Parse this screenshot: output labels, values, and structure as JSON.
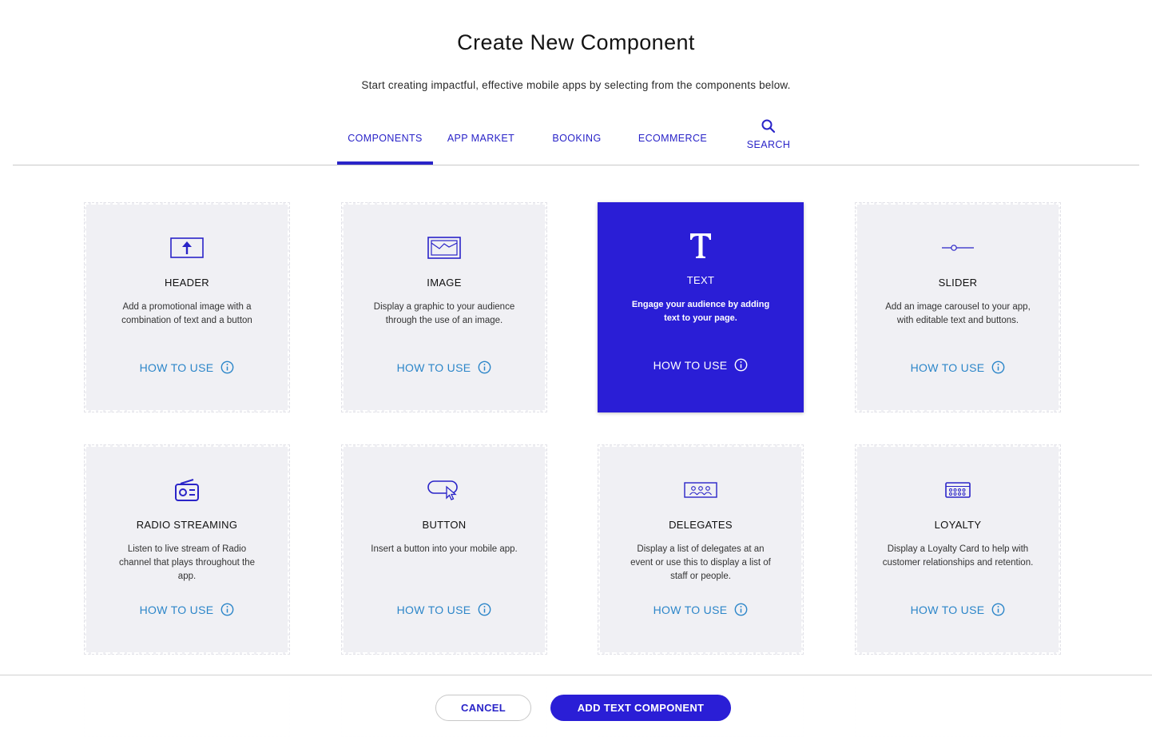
{
  "page": {
    "title": "Create New Component",
    "subtitle": "Start creating impactful, effective mobile apps by selecting from the components below."
  },
  "tabs": [
    {
      "label": "COMPONENTS",
      "active": true
    },
    {
      "label": "APP MARKET",
      "active": false
    },
    {
      "label": "BOOKING",
      "active": false
    },
    {
      "label": "ECOMMERCE",
      "active": false
    },
    {
      "label": "SEARCH",
      "active": false,
      "icon": "search-icon"
    }
  ],
  "how_to_use_label": "HOW TO USE",
  "components": [
    {
      "name": "HEADER",
      "icon": "header-icon",
      "description": "Add a promotional image with a combination of text and a button",
      "selected": false
    },
    {
      "name": "IMAGE",
      "icon": "image-icon",
      "description": "Display a graphic to your audience through the use of an image.",
      "selected": false
    },
    {
      "name": "TEXT",
      "icon": "text-icon",
      "description": "Engage your audience by adding text to your page.",
      "selected": true
    },
    {
      "name": "SLIDER",
      "icon": "slider-icon",
      "description": "Add an image carousel to your app, with editable text and buttons.",
      "selected": false
    },
    {
      "name": "RADIO STREAMING",
      "icon": "radio-icon",
      "description": "Listen to live stream of Radio channel that plays throughout the app.",
      "selected": false
    },
    {
      "name": "BUTTON",
      "icon": "button-icon",
      "description": "Insert a button into your mobile app.",
      "selected": false
    },
    {
      "name": "DELEGATES",
      "icon": "delegates-icon",
      "description": "Display a list of delegates at an event or use this to display a list of staff or people.",
      "selected": false
    },
    {
      "name": "LOYALTY",
      "icon": "loyalty-icon",
      "description": "Display a Loyalty Card to help with customer relationships and retention.",
      "selected": false
    }
  ],
  "footer": {
    "cancel_label": "CANCEL",
    "add_label": "ADD TEXT COMPONENT"
  },
  "colors": {
    "accent": "#2a1ed6",
    "link": "#2c86c9",
    "card_bg": "#f0f0f4"
  }
}
